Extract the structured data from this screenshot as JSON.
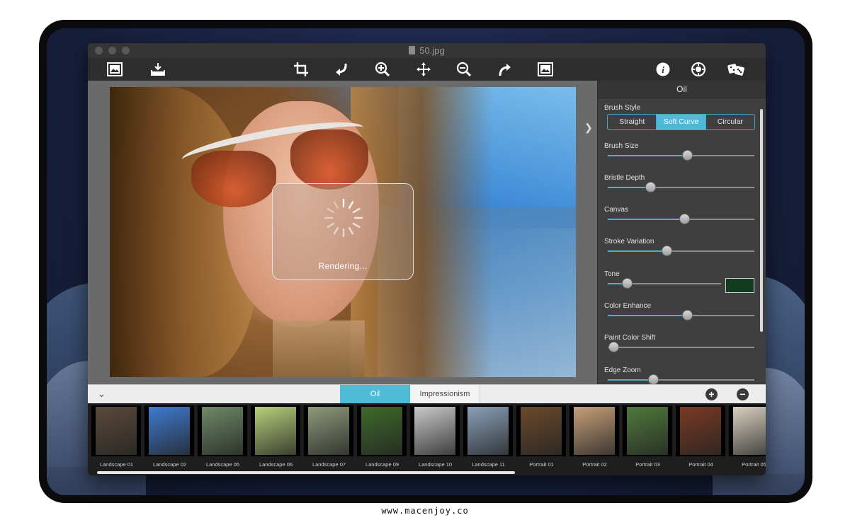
{
  "window": {
    "title": "50.jpg"
  },
  "toolbar": {
    "icons": [
      "open-image-icon",
      "save-image-icon",
      "crop-icon",
      "rotate-left-icon",
      "zoom-in-icon",
      "move-icon",
      "zoom-out-icon",
      "rotate-right-icon",
      "fit-image-icon",
      "info-icon",
      "settings-icon",
      "random-dice-icon"
    ]
  },
  "canvas": {
    "rendering_label": "Rendering..."
  },
  "panel": {
    "title": "Oil",
    "brush_style": {
      "label": "Brush Style",
      "options": [
        "Straight",
        "Soft Curve",
        "Circular"
      ],
      "selected": "Soft Curve"
    },
    "sliders": [
      {
        "label": "Brush Size",
        "value": 0.54
      },
      {
        "label": "Bristle Depth",
        "value": 0.29
      },
      {
        "label": "Canvas",
        "value": 0.52
      },
      {
        "label": "Stroke Variation",
        "value": 0.4
      },
      {
        "label": "Tone",
        "value": 0.17
      },
      {
        "label": "Color Enhance",
        "value": 0.54
      },
      {
        "label": "Paint Color Shift",
        "value": 0.04
      },
      {
        "label": "Edge Zoom",
        "value": 0.31
      }
    ],
    "tone_color": "#123b1f"
  },
  "tabs": {
    "items": [
      "Oil",
      "Impressionism"
    ],
    "active": "Oil",
    "add_label": "+",
    "remove_label": "−"
  },
  "presets": [
    {
      "label": "Landscape 01",
      "color": "#5a4a3a"
    },
    {
      "label": "Landscape 02",
      "color": "#3f7bd0"
    },
    {
      "label": "Landscape 05",
      "color": "#6f8a66"
    },
    {
      "label": "Landscape 06",
      "color": "#b8d07a"
    },
    {
      "label": "Landscape 07",
      "color": "#8e9a7a"
    },
    {
      "label": "Landscape 09",
      "color": "#3e6a2a"
    },
    {
      "label": "Landscape 10",
      "color": "#c9c9c9"
    },
    {
      "label": "Landscape 11",
      "color": "#8aa0b8"
    },
    {
      "label": "Portrait 01",
      "color": "#6b4a2c"
    },
    {
      "label": "Portrait 02",
      "color": "#c6a07a"
    },
    {
      "label": "Portrait 03",
      "color": "#4f7a3c"
    },
    {
      "label": "Portrait 04",
      "color": "#7a3a24"
    },
    {
      "label": "Portrait 05",
      "color": "#d8d0c0"
    }
  ],
  "footer": {
    "text": "www.macenjoy.co"
  },
  "colors": {
    "accent": "#4fbad6"
  }
}
